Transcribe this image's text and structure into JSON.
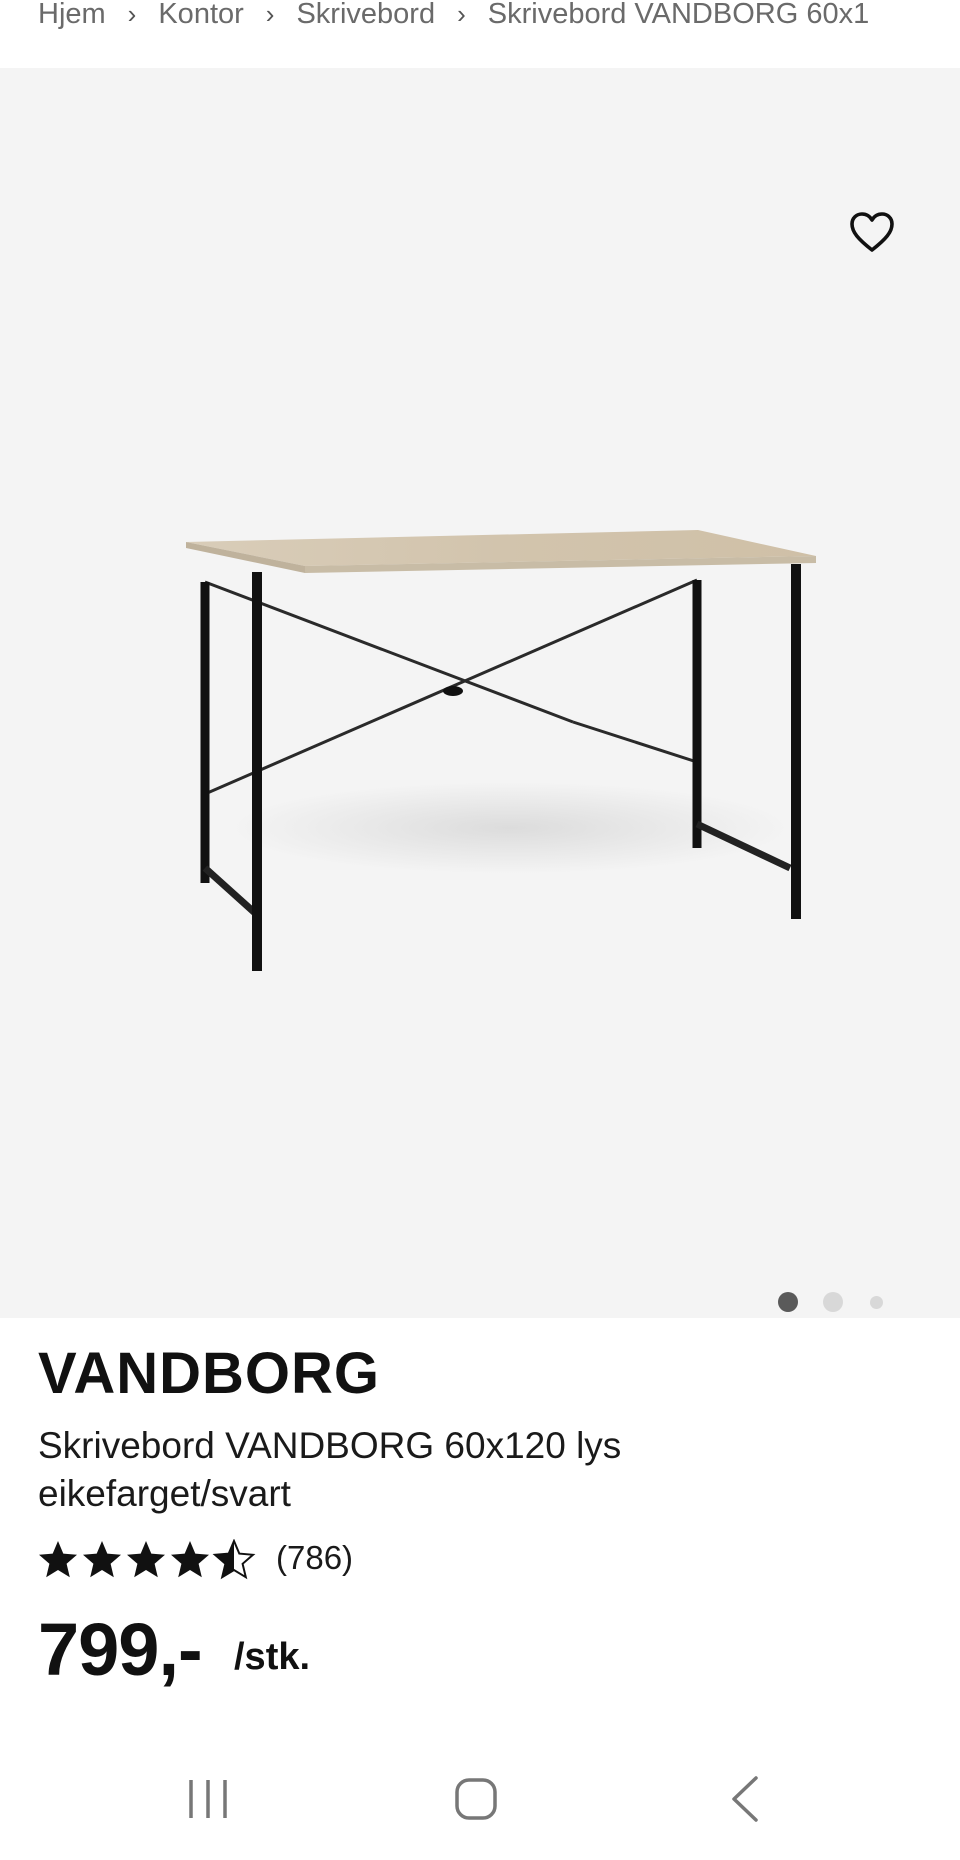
{
  "breadcrumb": {
    "items": [
      "Hjem",
      "Kontor",
      "Skrivebord",
      "Skrivebord VANDBORG 60x1"
    ],
    "separator": "›"
  },
  "gallery": {
    "favorite_icon": "heart-outline-icon",
    "image_description_hidden": false,
    "current_slide": 1,
    "slide_count": 3
  },
  "product": {
    "brand": "VANDBORG",
    "name": "Skrivebord VANDBORG 60x120 lys eikefarget/svart",
    "rating": 4.5,
    "rating_max": 5,
    "review_count": "(786)",
    "price": "799,-",
    "unit": "/stk."
  },
  "system_nav": {
    "icons": [
      "recent-apps-icon",
      "home-icon",
      "back-icon"
    ]
  },
  "colors": {
    "gallery_bg": "#f4f4f4",
    "text": "#111111",
    "dot_active": "#5a5a5a",
    "dot_inactive": "#d8d8d8"
  }
}
